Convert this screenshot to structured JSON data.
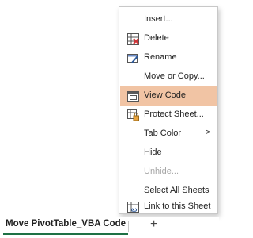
{
  "context_menu": {
    "items": [
      {
        "label": "Insert...",
        "icon": "insert-sheet-icon"
      },
      {
        "label": "Delete",
        "icon": "delete-sheet-icon"
      },
      {
        "label": "Rename",
        "icon": "rename-icon"
      },
      {
        "label": "Move or Copy...",
        "icon": ""
      },
      {
        "label": "View Code",
        "icon": "view-code-icon",
        "highlighted": true
      },
      {
        "label": "Protect Sheet...",
        "icon": "protect-sheet-icon"
      },
      {
        "label": "Tab Color",
        "icon": "",
        "submenu_arrow": ">"
      },
      {
        "label": "Hide",
        "icon": ""
      },
      {
        "label": "Unhide...",
        "icon": "",
        "disabled": true
      },
      {
        "label": "Select All Sheets",
        "icon": ""
      },
      {
        "label": "Link to this Sheet",
        "icon": "link-sheet-icon"
      }
    ]
  },
  "sheet_tabs": {
    "active_tab": "Move PivotTable_VBA Code",
    "add_sheet_label": "+"
  },
  "colors": {
    "highlight": "#f1c4a4",
    "active_tab_underline": "#1e7145",
    "disabled_text": "#a6a6a6"
  }
}
